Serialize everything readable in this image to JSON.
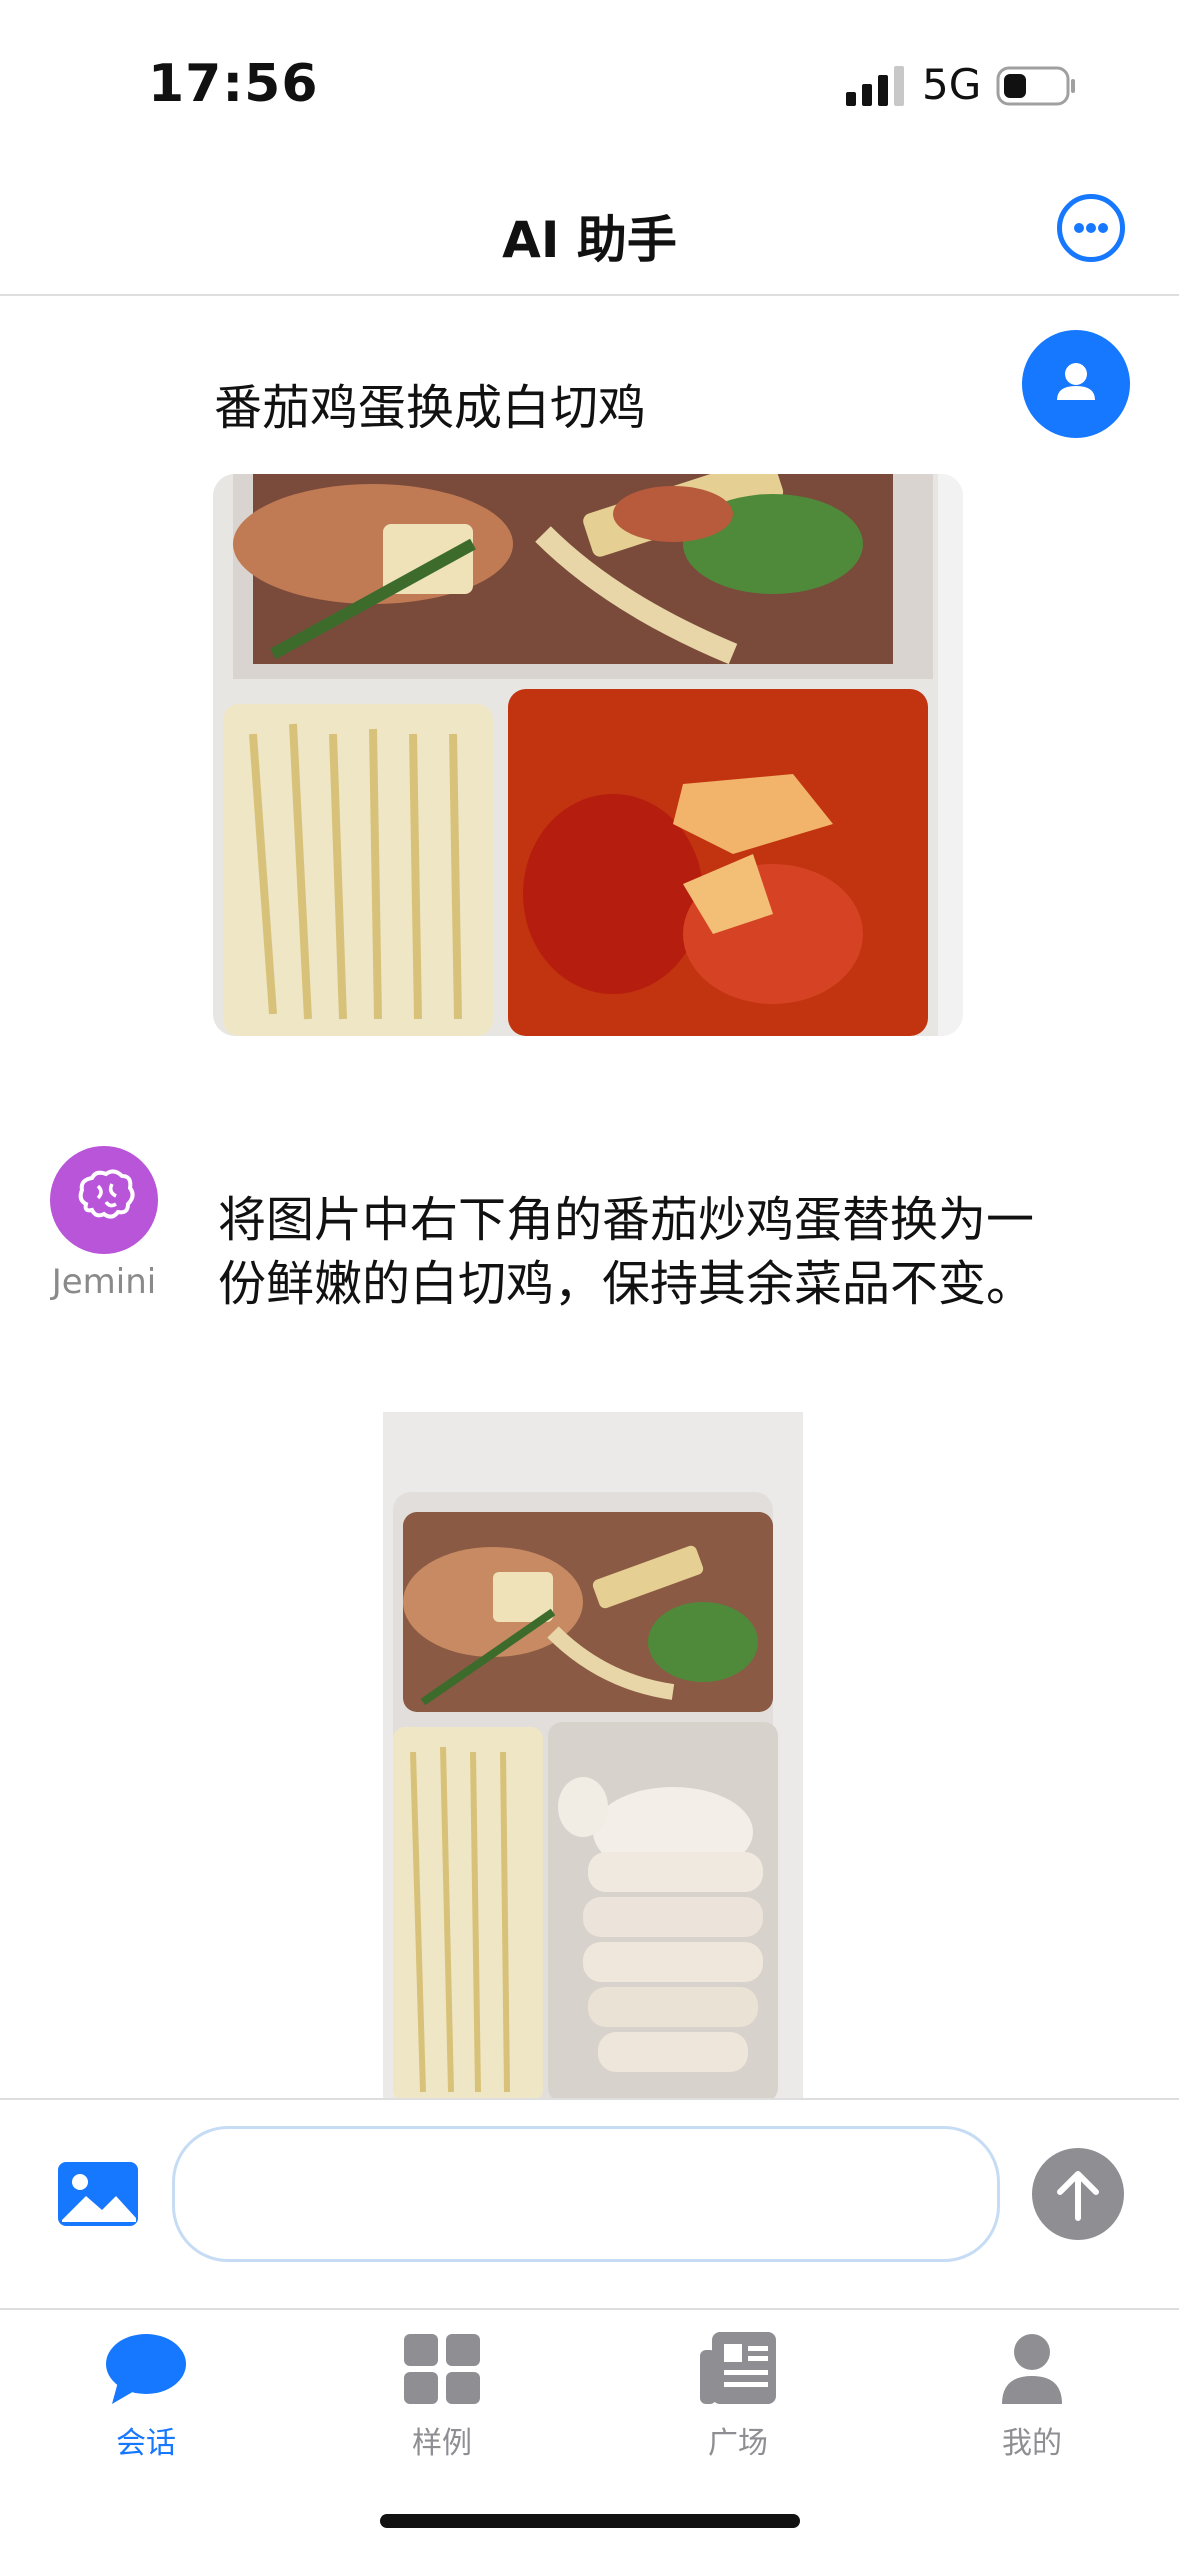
{
  "status_bar": {
    "time": "17:56",
    "network": "5G"
  },
  "nav": {
    "title": "AI 助手",
    "more_icon": "more-icon"
  },
  "conversation": {
    "user_message": {
      "text": "番茄鸡蛋换成白切鸡",
      "image_alt": "盒饭照片：番茄炒鸡蛋、土豆丝、凉拌菜"
    },
    "ai_message": {
      "assistant_name": "Jemini",
      "text": "将图片中右下角的番茄炒鸡蛋替换为一份鲜嫩的白切鸡，保持其余菜品不变。",
      "image_alt": "编辑后盒饭照片：白切鸡、土豆丝、凉拌菜"
    }
  },
  "input": {
    "placeholder": "",
    "value": ""
  },
  "tabs": [
    {
      "label": "会话",
      "icon": "chat-bubble-icon",
      "active": true
    },
    {
      "label": "样例",
      "icon": "grid-icon",
      "active": false
    },
    {
      "label": "广场",
      "icon": "newspaper-icon",
      "active": false
    },
    {
      "label": "我的",
      "icon": "person-icon",
      "active": false
    }
  ],
  "colors": {
    "accent": "#1677ff",
    "assistant_avatar": "#b855d9",
    "send_button": "#8e8e93"
  }
}
